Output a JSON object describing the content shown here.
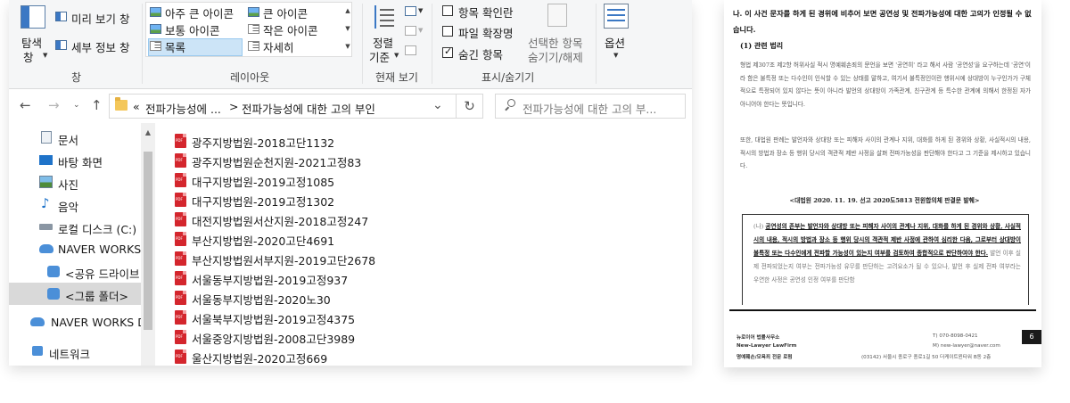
{
  "ribbon": {
    "pane": {
      "nav_label_1": "탐색",
      "nav_label_2": "창",
      "preview": "미리 보기 창",
      "details": "세부 정보 창",
      "group": "창"
    },
    "layout": {
      "items": [
        "아주 큰 아이콘",
        "큰 아이콘",
        "보통 아이콘",
        "작은 아이콘",
        "목록",
        "자세히"
      ],
      "group": "레이아웃"
    },
    "view": {
      "sort_1": "정렬",
      "sort_2": "기준",
      "group": "현재 보기"
    },
    "show": {
      "checkbox_label": "항목 확인란",
      "ext_label": "파일 확장명",
      "hidden_label": "숨긴 항목",
      "hide_sel_1": "선택한 항목",
      "hide_sel_2": "숨기기/해제",
      "group": "표시/숨기기"
    },
    "options": "옵션"
  },
  "address": {
    "breadcrumb_overflow": "«",
    "parent": "전파가능성에 ...",
    "sep": ">",
    "current": "전파가능성에 대한 고의 부인",
    "search_placeholder": "전파가능성에 대한 고의 부..."
  },
  "sidebar": {
    "items": [
      "문서",
      "바탕 화면",
      "사진",
      "음악",
      "로컬 디스크 (C:)",
      "NAVER WORKS",
      "<공유 드라이브",
      "<그룹 폴더>",
      "NAVER WORKS D",
      "네트워크"
    ]
  },
  "files": [
    "광주지방법원-2018고단1132",
    "광주지방법원순천지원-2021고정83",
    "대구지방법원-2019고정1085",
    "대구지방법원-2019고정1302",
    "대전지방법원서산지원-2018고정247",
    "부산지방법원-2020고단4691",
    "부산지방법원서부지원-2019고단2678",
    "서울동부지방법원-2019고정937",
    "서울동부지방법원-2020노30",
    "서울북부지방법원-2019고정4375",
    "서울중앙지방법원-2008고단3989",
    "울산지방법원-2020고정669"
  ],
  "doc": {
    "heading": "나. 이 사건 문자를 하게 된 경위에 비추어 보면 공연성 및 전파가능성에 대한 고의가 인정될 수 없습니다.",
    "sub": "(1) 관련 법리",
    "para1": "형법 제307조 제2항 허위사실 적시 명예훼손죄의 문언을 보면 '공연히' 라고 해서 사람 '공연성'을 요구하는데 '공연'이라 함은 불특정 또는 다수인이 인식할 수 있는 상태를 말하고, 여기서 불특정인이란 행위시에 상대방이 누구인가가 구체적으로 특정되어 있지 않다는 뜻이 아니라 발언의 상대방이 가족관계, 친구관계 등 특수한 관계에 의해서 한정된 자가 아니어야 한다는 뜻입니다.",
    "para2": "또한, 대법원 판례는 발언자와 상대방 또는 피해자 사이의 관계나 지위, 대화를 하게 된 경위와 상황, 사실적시의 내용, 적시의 방법과 장소 등 행위 당시의 객관적 제반 사정을 살펴 전파가능성을 판단해야 한다고 그 기준을 제시하고 있습니다.",
    "caption": "<대법원 2020. 11. 19. 선고 2020도5813 전원합의체 판결문 발췌>",
    "box_prefix": "(나) ",
    "box_bold": "공연성의 존부는 발언자와 상대방 또는 피해자 사이의 관계나 지위, 대화를 하게 된 경위와 상황, 사실적시의 내용, 적시의 방법과 장소 등 행위 당시의 객관적 제반 사정에 관하여 심리한 다음, 그로부터 상대방이 불특정 또는 다수인에게 전파할 가능성이 있는지 여부를 검토하여 종합적으로 판단하여야 한다.",
    "box_rest": " 발언 이후 실제 전파되었는지 여부는 전파가능성 유무를 판단하는 고려요소가 될 수 있으나, 발언 후 실제 전파 여부라는 우연한 사정은 공연성 인정 여부를 판단함",
    "footer": {
      "firm1": "뉴로이어 법률사무소",
      "firm2": "New-Lawyer LawFirm",
      "firm3": "명예훼손/모욕죄 전문 로펌",
      "tel": "T) 070-8098-0421",
      "mail": "M) new-lawyer@naver.com",
      "addr": "(03142) 서울시 종로구 종로1길 50 더케이트윈타워 B동 2층",
      "page": "6"
    }
  },
  "colors": {
    "pdf_red": "#d4262d",
    "selection": "#cce4f7",
    "folder": "#f4c75a"
  }
}
